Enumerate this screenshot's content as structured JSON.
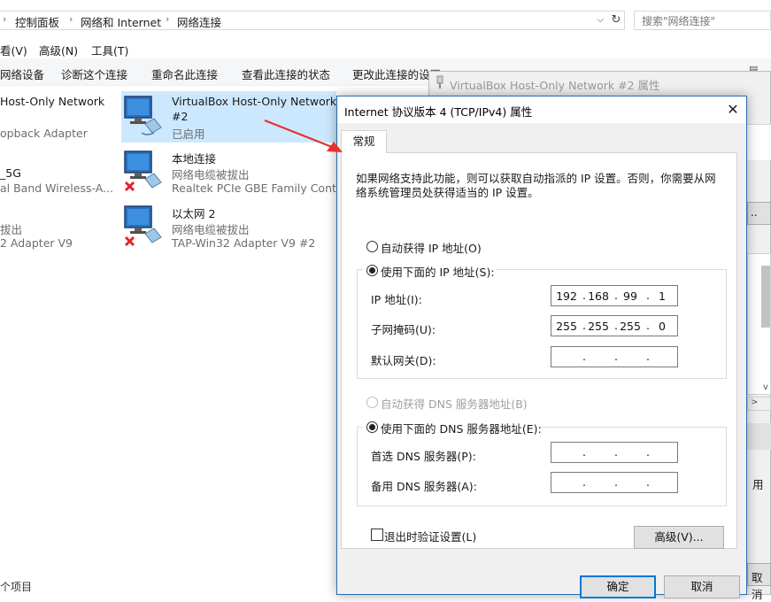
{
  "explorer": {
    "breadcrumb": [
      "控制面板",
      "网络和 Internet",
      "网络连接"
    ],
    "search_placeholder": "搜索\"网络连接\"",
    "menu": [
      "看(V)",
      "高级(N)",
      "工具(T)"
    ],
    "commands": [
      "网络设备",
      "诊断这个连接",
      "重命名此连接",
      "查看此连接的状态",
      "更改此连接的设置"
    ],
    "left_items": [
      {
        "name": "Host-Only Network",
        "sub": "opback Adapter"
      },
      {
        "name": "_5G",
        "sub": "al Band Wireless-A..."
      },
      {
        "name": "拔出",
        "sub": "2 Adapter V9"
      }
    ],
    "items": [
      {
        "name1": "VirtualBox Host-Only Network",
        "name2": "#2",
        "status": "已启用",
        "adapter": "",
        "selected": true,
        "disconnected": false
      },
      {
        "name1": "本地连接",
        "name2": "",
        "status": "网络电缆被拔出",
        "adapter": "Realtek PCIe GBE Family Contr...",
        "selected": false,
        "disconnected": true
      },
      {
        "name1": "以太网 2",
        "name2": "",
        "status": "网络电缆被拔出",
        "adapter": "TAP-Win32 Adapter V9 #2",
        "selected": false,
        "disconnected": true
      }
    ],
    "status_bar": "个项目"
  },
  "bg_dialog": {
    "title": "VirtualBox Host-Only Network #2 属性",
    "right_edge_texts": [
      "用",
      "取消"
    ]
  },
  "dialog": {
    "title": "Internet 协议版本 4 (TCP/IPv4) 属性",
    "close_glyph": "✕",
    "tab": "常规",
    "intro_line1": "如果网络支持此功能，则可以获取自动指派的 IP 设置。否则，你需要从网",
    "intro_line2": "络系统管理员处获得适当的 IP 设置。",
    "ip_auto_label": "自动获得 IP 地址(O)",
    "ip_manual_label": "使用下面的 IP 地址(S):",
    "ip_mode": "manual",
    "ip_address_label": "IP 地址(I):",
    "ip_address": [
      "192",
      "168",
      "99",
      "1"
    ],
    "subnet_label": "子网掩码(U):",
    "subnet": [
      "255",
      "255",
      "255",
      "0"
    ],
    "gateway_label": "默认网关(D):",
    "gateway": [
      "",
      "",
      "",
      ""
    ],
    "dns_auto_label": "自动获得 DNS 服务器地址(B)",
    "dns_manual_label": "使用下面的 DNS 服务器地址(E):",
    "dns_mode": "manual",
    "dns_pref_label": "首选 DNS 服务器(P):",
    "dns_pref": [
      "",
      "",
      "",
      ""
    ],
    "dns_alt_label": "备用 DNS 服务器(A):",
    "dns_alt": [
      "",
      "",
      "",
      ""
    ],
    "validate_label": "退出时验证设置(L)",
    "validate_checked": false,
    "advanced_button": "高级(V)...",
    "ok_button": "确定",
    "cancel_button": "取消"
  },
  "colors": {
    "accent": "#0078d7",
    "selection": "#cce8ff",
    "arrow": "#e8302c"
  }
}
